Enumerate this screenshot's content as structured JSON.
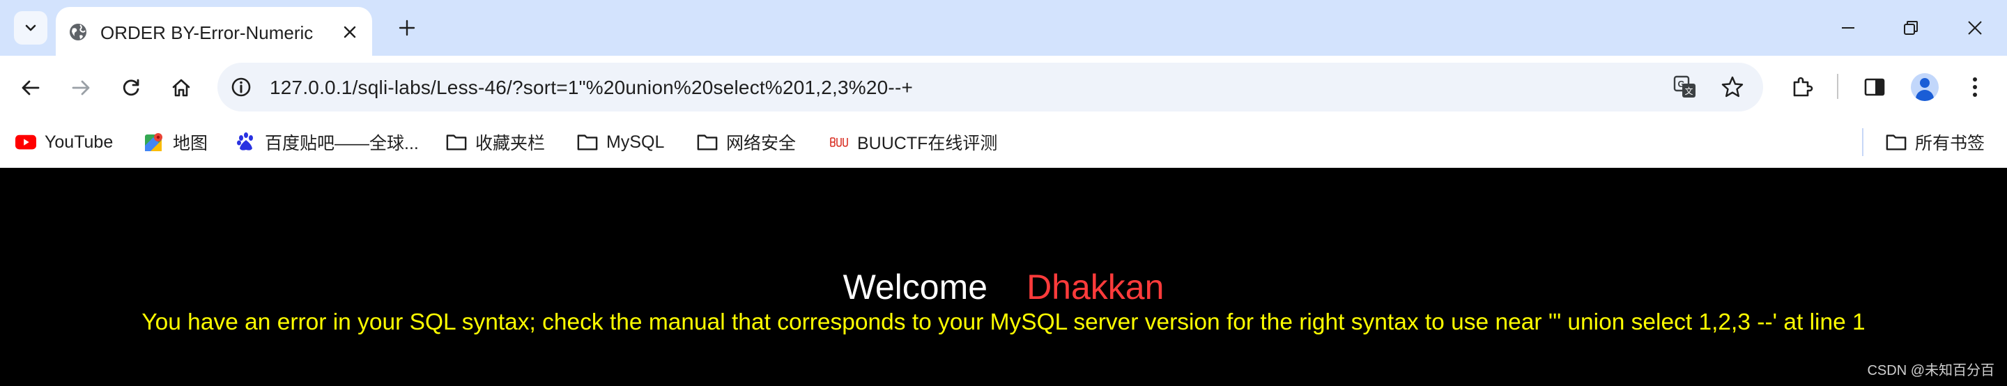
{
  "tab": {
    "title": "ORDER BY-Error-Numeric"
  },
  "address_bar": {
    "url": "127.0.0.1/sqli-labs/Less-46/?sort=1\"%20union%20select%201,2,3%20--+"
  },
  "bookmarks": [
    {
      "label": "YouTube",
      "icon": "youtube-icon"
    },
    {
      "label": "地图",
      "icon": "maps-icon"
    },
    {
      "label": "百度贴吧——全球...",
      "icon": "baidu-icon"
    },
    {
      "label": "收藏夹栏",
      "icon": "folder-icon"
    },
    {
      "label": "MySQL",
      "icon": "folder-icon"
    },
    {
      "label": "网络安全",
      "icon": "folder-icon"
    },
    {
      "label": "BUUCTF在线评测",
      "icon": "buuctf-icon"
    }
  ],
  "all_bookmarks": {
    "label": "所有书签"
  },
  "page": {
    "welcome": "Welcome",
    "name": "Dhakkan",
    "error": "You have an error in your SQL syntax; check the manual that corresponds to your MySQL server version for the right syntax to use near '\" union select 1,2,3 --' at line 1"
  },
  "watermark": "CSDN @未知百分百",
  "colors": {
    "tabstrip": "#d3e3fd",
    "omnibox": "#eff3fa",
    "page_bg": "#000000",
    "welcome": "#ffffff",
    "name": "#ff3b3b",
    "error": "#ffff00"
  }
}
